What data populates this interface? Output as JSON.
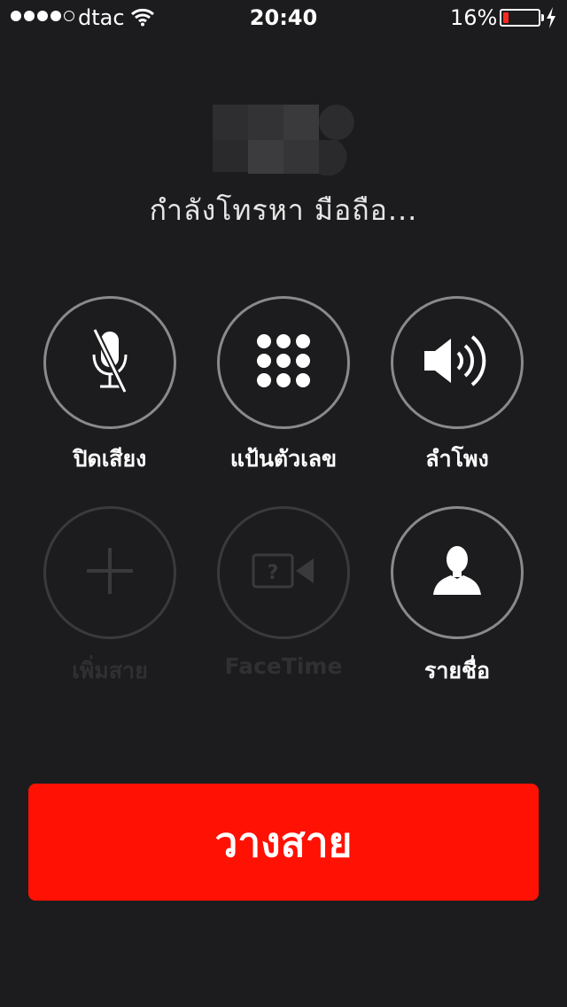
{
  "status_bar": {
    "carrier": "dtac",
    "time": "20:40",
    "battery_percent": "16%",
    "battery_level": 0.16,
    "signal_bars_filled": 4,
    "signal_bars_total": 5
  },
  "call": {
    "status": "กำลังโทรหา มือถือ..."
  },
  "buttons": {
    "mute": {
      "label": "ปิดเสียง",
      "icon": "mic-muted-icon",
      "enabled": true
    },
    "keypad": {
      "label": "แป้นตัวเลข",
      "icon": "keypad-icon",
      "enabled": true
    },
    "speaker": {
      "label": "ลำโพง",
      "icon": "speaker-icon",
      "enabled": true
    },
    "add_call": {
      "label": "เพิ่มสาย",
      "icon": "plus-icon",
      "enabled": false
    },
    "facetime": {
      "label": "FaceTime",
      "icon": "facetime-icon",
      "enabled": false
    },
    "contacts": {
      "label": "รายชื่อ",
      "icon": "contact-icon",
      "enabled": true
    }
  },
  "end_call": {
    "label": "วางสาย"
  },
  "colors": {
    "background": "#1c1c1e",
    "end_call": "#ff1104",
    "battery_low": "#ff2a1f"
  }
}
